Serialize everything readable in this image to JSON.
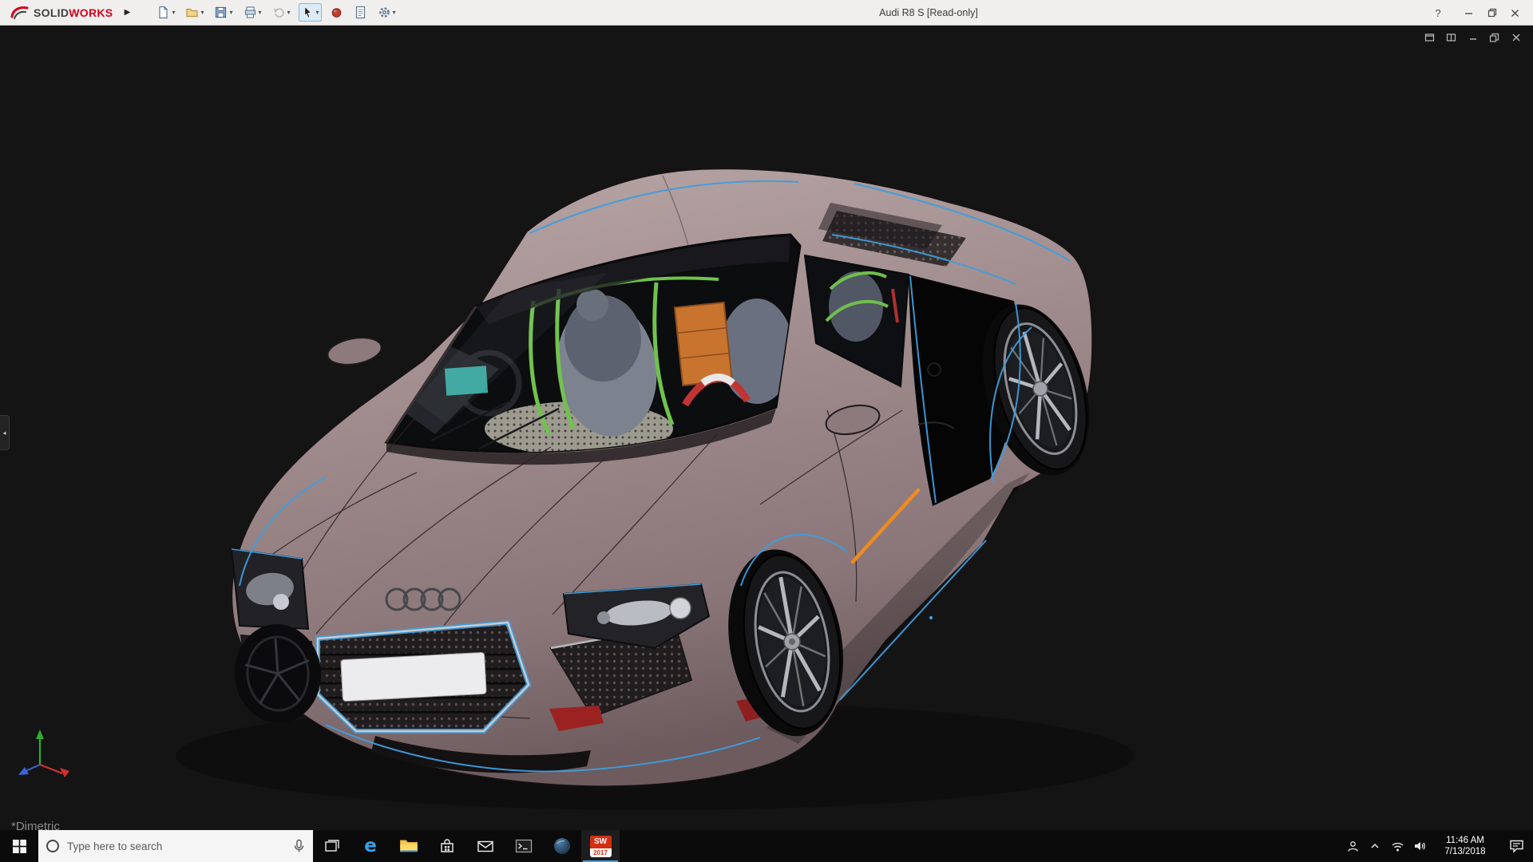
{
  "titlebar": {
    "brand_solid": "SOLID",
    "brand_works": "WORKS",
    "flyout_arrow": "▶",
    "title": "Audi R8 S [Read-only]",
    "help_glyph": "?",
    "window_controls": [
      "help",
      "minimize",
      "restore",
      "close"
    ],
    "toolbar_icons": [
      "new-document",
      "open",
      "save",
      "print",
      "undo",
      "select-cursor",
      "record-dot",
      "file-properties",
      "options-gear"
    ]
  },
  "glyphs": {
    "dropdown_chevron": "▾",
    "panel_tab_arrow": "◂"
  },
  "viewport": {
    "view_label": "*Dimetric",
    "doc_controls": [
      "float-window",
      "tile-window",
      "minimize",
      "restore",
      "close"
    ]
  },
  "taskbar": {
    "search_placeholder": "Type here to search",
    "edge_glyph": "e",
    "solidworks_label": "SW",
    "solidworks_year": "2017",
    "time": "11:46 AM",
    "date": "7/13/2018",
    "app_icons": [
      "start",
      "search",
      "task-view",
      "edge",
      "file-explorer",
      "store",
      "mail",
      "command-prompt",
      "blue-sphere-app",
      "solidworks-2017"
    ]
  },
  "colors": {
    "car_body": "#9d8889",
    "edge_highlight": "#3f9ddd",
    "selection_orange": "#ef8b1f",
    "titlebar_bg": "#f0efed",
    "viewport_bg": "#141414",
    "taskbar_bg": "#0b0b0b"
  }
}
